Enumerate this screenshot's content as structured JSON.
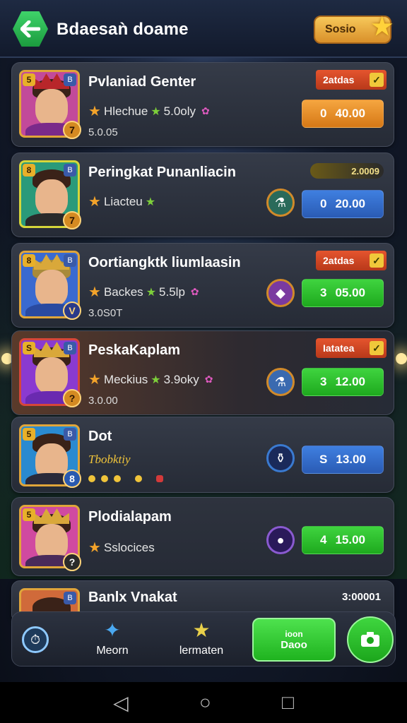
{
  "header": {
    "title": "Bdaesaǹ doame",
    "badge_label": "Sosio"
  },
  "players": [
    {
      "name": "Pvlaniad Genter",
      "level": "5",
      "rank_chip": "B",
      "rank": "7",
      "sub_text": "Hlechue",
      "sub_value": "5.0oly",
      "extra": "5.0.05",
      "tag": "2atdas",
      "price_value": "0",
      "price_amount": "40.00",
      "price_color": "orange",
      "avatar_color": "#c24a9a",
      "body_color": "#7a2a8a"
    },
    {
      "name": "Peringkat Punanliacin",
      "level": "8",
      "rank_chip": "B",
      "rank": "7",
      "sub_text": "Liacteu",
      "pill_tag": "2.0009",
      "price_value": "0",
      "price_amount": "20.00",
      "price_color": "blue",
      "avatar_color": "#2a9a7a",
      "body_color": "#2a2a2a"
    },
    {
      "name": "Oortiangktk liumlaasin",
      "level": "8",
      "rank_chip": "B",
      "rank": "V",
      "sub_text": "Backes",
      "sub_value": "5.5lp",
      "extra": "3.0S0T",
      "tag": "2atdas",
      "price_value": "3",
      "price_amount": "05.00",
      "price_color": "green",
      "avatar_color": "#3a6ad0",
      "body_color": "#2a4aa0"
    },
    {
      "name": "PeskaKaplam",
      "level": "S",
      "rank_chip": "B",
      "rank": "?",
      "sub_text": "Meckius",
      "sub_value": "3.9oky",
      "extra": "3.0.00",
      "tag": "Iatatea",
      "price_value": "3",
      "price_amount": "12.00",
      "price_color": "green",
      "avatar_color": "#8a3ad0",
      "body_color": "#6a2ab0"
    },
    {
      "name": "Dot",
      "level": "5",
      "rank_chip": "B",
      "rank": "8",
      "sub_text": "Tbobktiy",
      "price_value": "S",
      "price_amount": "13.00",
      "price_color": "blue",
      "avatar_color": "#2a8ad0",
      "body_color": "#2a2a3a"
    },
    {
      "name": "Plodialapam",
      "level": "5",
      "rank_chip": "",
      "rank": "?",
      "sub_text": "Sslocices",
      "price_value": "4",
      "price_amount": "15.00",
      "price_color": "green",
      "avatar_color": "#d04aa0",
      "body_color": "#4a2a5a"
    },
    {
      "name": "Banlx Vnakat",
      "level": "",
      "rank_chip": "B",
      "value": "3:00001",
      "avatar_color": "#d06a3a"
    }
  ],
  "bottom_nav": {
    "item1_label": "Meorn",
    "item2_label": "lermaten",
    "play_line1": "ioon",
    "play_line2": "Daoo"
  },
  "colors": {
    "accent_green": "#1ea91e",
    "accent_orange": "#d67816",
    "accent_blue": "#2a5bb4"
  }
}
